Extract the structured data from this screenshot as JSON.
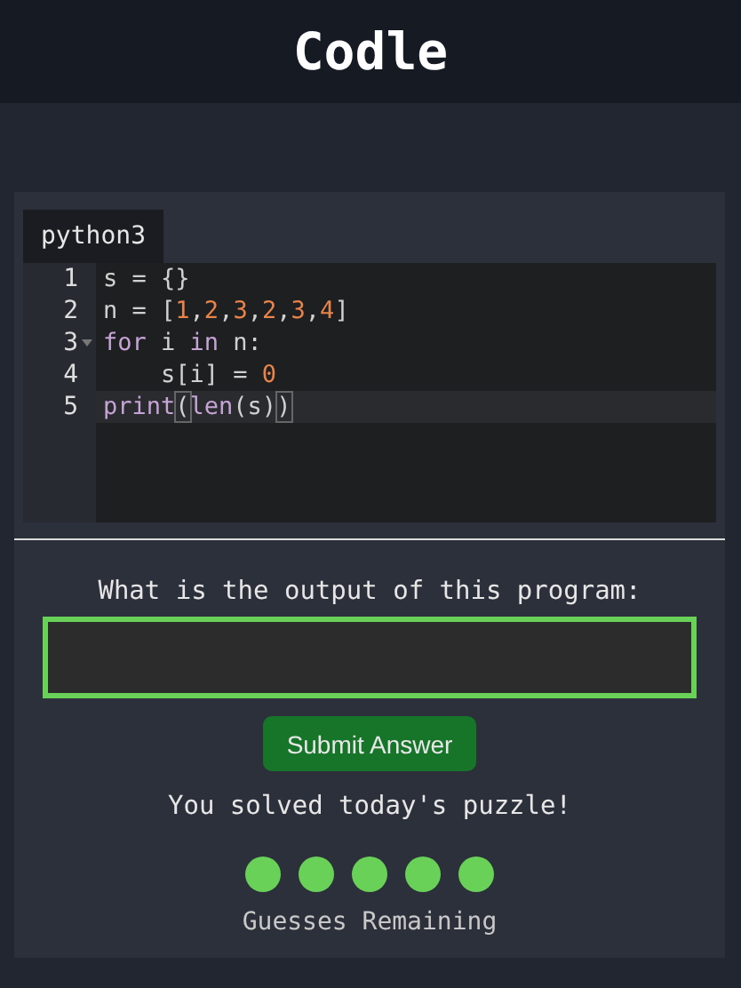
{
  "header": {
    "title": "Codle"
  },
  "editor": {
    "language_tab": "python3",
    "lines": [
      {
        "number": "1",
        "foldable": false,
        "active": false,
        "tokens": [
          {
            "text": "s = {}",
            "kind": "plain"
          }
        ]
      },
      {
        "number": "2",
        "foldable": false,
        "active": false,
        "tokens": [
          {
            "text": "n = [",
            "kind": "plain"
          },
          {
            "text": "1",
            "kind": "num"
          },
          {
            "text": ",",
            "kind": "plain"
          },
          {
            "text": "2",
            "kind": "num"
          },
          {
            "text": ",",
            "kind": "plain"
          },
          {
            "text": "3",
            "kind": "num"
          },
          {
            "text": ",",
            "kind": "plain"
          },
          {
            "text": "2",
            "kind": "num"
          },
          {
            "text": ",",
            "kind": "plain"
          },
          {
            "text": "3",
            "kind": "num"
          },
          {
            "text": ",",
            "kind": "plain"
          },
          {
            "text": "4",
            "kind": "num"
          },
          {
            "text": "]",
            "kind": "plain"
          }
        ]
      },
      {
        "number": "3",
        "foldable": true,
        "active": false,
        "tokens": [
          {
            "text": "for",
            "kind": "keyword"
          },
          {
            "text": " i ",
            "kind": "plain"
          },
          {
            "text": "in",
            "kind": "keyword"
          },
          {
            "text": " n:",
            "kind": "plain"
          }
        ]
      },
      {
        "number": "4",
        "foldable": false,
        "active": false,
        "tokens": [
          {
            "text": "    s[i] = ",
            "kind": "plain"
          },
          {
            "text": "0",
            "kind": "num"
          }
        ]
      },
      {
        "number": "5",
        "foldable": false,
        "active": true,
        "tokens": [
          {
            "text": "print",
            "kind": "keyword"
          },
          {
            "text": "(",
            "kind": "matched-bracket"
          },
          {
            "text": "len",
            "kind": "builtin"
          },
          {
            "text": "(s)",
            "kind": "plain"
          },
          {
            "text": ")",
            "kind": "matched-bracket"
          }
        ]
      }
    ]
  },
  "question": {
    "label": "What is the output of this program:",
    "button": "Submit Answer"
  },
  "status": "You solved today's puzzle!",
  "guesses": {
    "dots": [
      {
        "used": false
      },
      {
        "used": false
      },
      {
        "used": false
      },
      {
        "used": false
      },
      {
        "used": false
      }
    ],
    "label": "Guesses Remaining"
  }
}
